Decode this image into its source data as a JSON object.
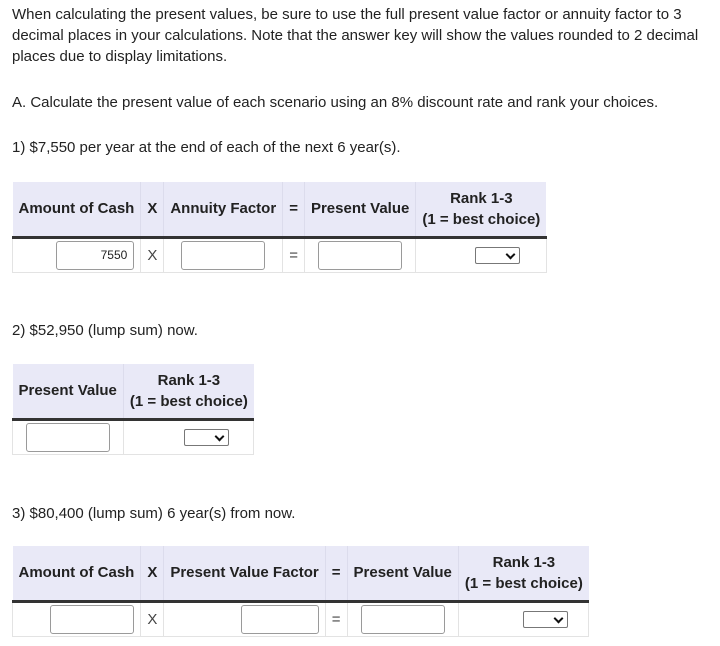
{
  "instructions": "When calculating the present values, be sure to use the full present value factor or annuity factor to 3 decimal places in your calculations. Note that the answer key will show the values rounded to 2 decimal places due to display limitations.",
  "part_a": "A. Calculate the present value of each scenario using an 8% discount rate and rank your choices.",
  "scenario1": {
    "label": "1) $7,550 per year at the end of each of the next 6 year(s).",
    "headers": {
      "amount": "Amount of Cash",
      "x": "X",
      "factor": "Annuity Factor",
      "eq": "=",
      "pv": "Present Value",
      "rank1": "Rank 1-3",
      "rank2": "(1 = best choice)"
    },
    "row": {
      "amount": "7550",
      "x": "X",
      "factor": "",
      "eq": "=",
      "pv": "",
      "rank": ""
    }
  },
  "scenario2": {
    "label": "2) $52,950 (lump sum) now.",
    "headers": {
      "pv": "Present Value",
      "rank1": "Rank 1-3",
      "rank2": "(1 = best choice)"
    },
    "row": {
      "pv": "",
      "rank": ""
    }
  },
  "scenario3": {
    "label": "3) $80,400 (lump sum) 6 year(s) from now.",
    "headers": {
      "amount": "Amount of Cash",
      "x": "X",
      "factor": "Present Value Factor",
      "eq": "=",
      "pv": "Present Value",
      "rank1": "Rank 1-3",
      "rank2": "(1 = best choice)"
    },
    "row": {
      "amount": "",
      "x": "X",
      "factor": "",
      "eq": "=",
      "pv": "",
      "rank": ""
    }
  }
}
